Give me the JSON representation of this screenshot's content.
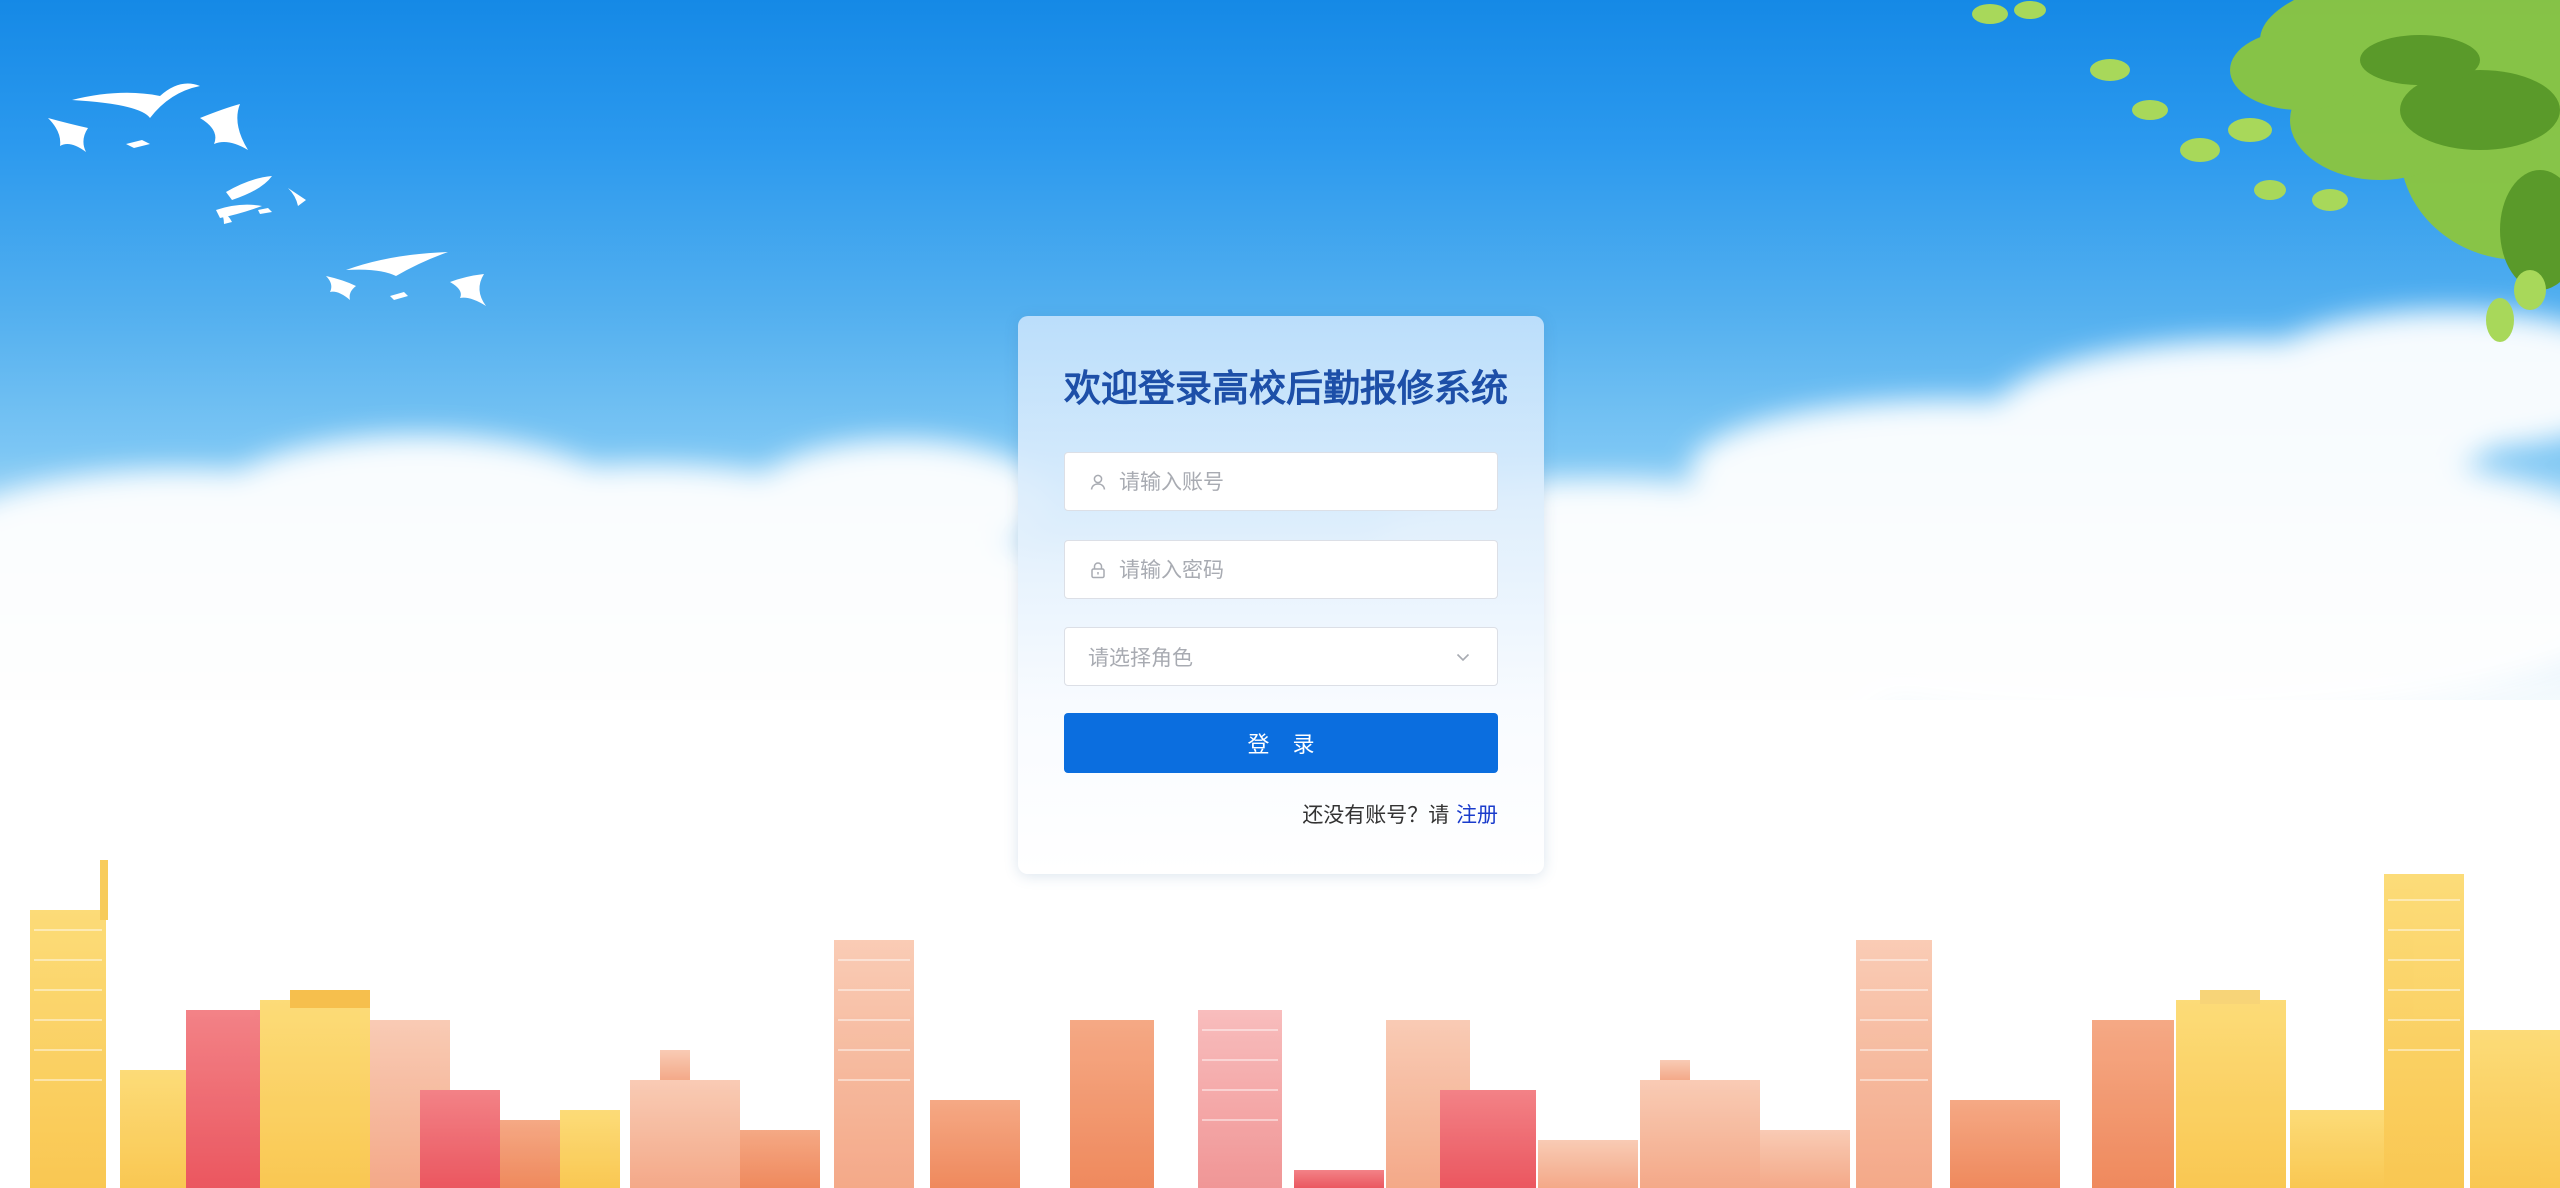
{
  "login": {
    "title": "欢迎登录高校后勤报修系统",
    "username_placeholder": "请输入账号",
    "password_placeholder": "请输入密码",
    "role_placeholder": "请选择角色",
    "submit_label": "登 录",
    "register_prompt": "还没有账号？请",
    "register_link": "注册"
  },
  "icons": {
    "username": "user-icon",
    "password": "lock-icon",
    "role": "chevron-down-icon"
  },
  "colors": {
    "title": "#1d4fa8",
    "button": "#0b6edf",
    "link": "#1a3ccc",
    "sky_top": "#1589e6"
  }
}
